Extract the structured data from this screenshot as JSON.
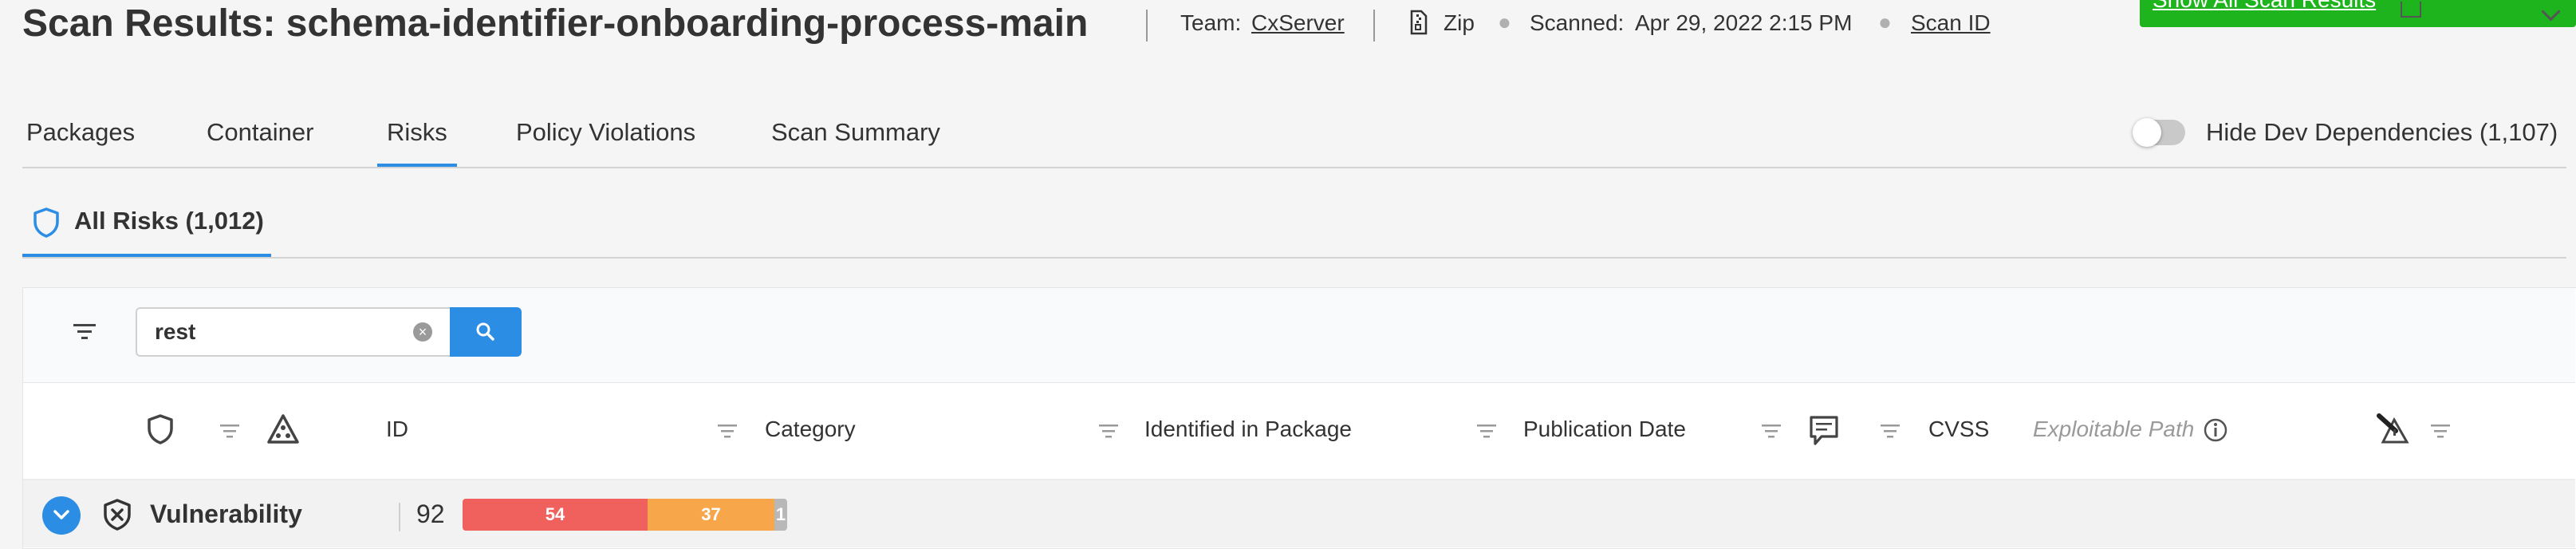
{
  "header": {
    "title": "Scan Results: schema-identifier-onboarding-process-main",
    "team_label": "Team:",
    "team_value": "CxServer",
    "source_type": "Zip",
    "scanned_label": "Scanned:",
    "scanned_value": "Apr 29, 2022 2:15 PM",
    "scan_id_link": "Scan ID",
    "show_all_button": "Show All Scan Results"
  },
  "tabs": [
    {
      "label": "Packages"
    },
    {
      "label": "Container"
    },
    {
      "label": "Risks",
      "active": true
    },
    {
      "label": "Policy Violations"
    },
    {
      "label": "Scan Summary"
    }
  ],
  "toggle": {
    "label": "Hide Dev Dependencies (1,107)",
    "on": false
  },
  "subtab": {
    "label": "All Risks (1,012)"
  },
  "search": {
    "value": "rest"
  },
  "columns": {
    "id": "ID",
    "category": "Category",
    "package": "Identified in Package",
    "publication_date": "Publication Date",
    "cvss": "CVSS",
    "exploitable_path": "Exploitable Path"
  },
  "group": {
    "label": "Vulnerability",
    "count": "92",
    "severity": [
      {
        "label": "54",
        "value": 54,
        "color": "#f0605d"
      },
      {
        "label": "37",
        "value": 37,
        "color": "#f7a64a"
      },
      {
        "label": "1",
        "value": 1,
        "color": "#b8b8b8"
      }
    ]
  },
  "colors": {
    "accent": "#2b8de3",
    "green": "#1db41d"
  }
}
